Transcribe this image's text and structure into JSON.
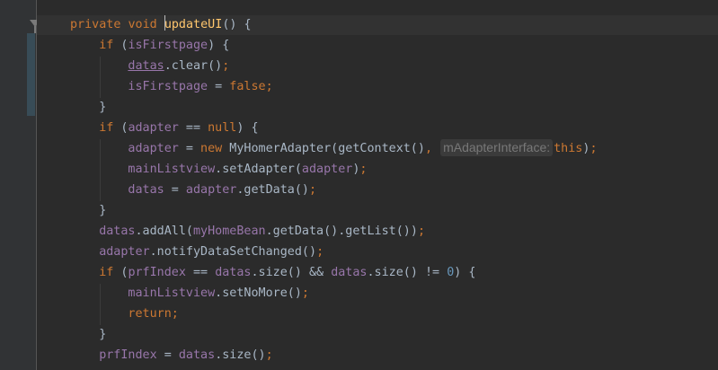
{
  "editor": {
    "lines": [
      {
        "indent": 0,
        "guides": [],
        "tokens": [
          {
            "t": "private void ",
            "c": "k"
          },
          {
            "t": "updateUI",
            "c": "m",
            "cursor_before": true
          },
          {
            "t": "() {",
            "c": "p"
          }
        ]
      },
      {
        "indent": 1,
        "guides": [],
        "tokens": [
          {
            "t": "if ",
            "c": "k"
          },
          {
            "t": "(",
            "c": "p"
          },
          {
            "t": "isFirstpage",
            "c": "f"
          },
          {
            "t": ") {",
            "c": "p"
          }
        ]
      },
      {
        "indent": 2,
        "guides": [
          1
        ],
        "tokens": [
          {
            "t": "datas",
            "c": "mu"
          },
          {
            "t": ".clear()",
            "c": "p"
          },
          {
            "t": ";",
            "c": "k"
          }
        ]
      },
      {
        "indent": 2,
        "guides": [
          1
        ],
        "tokens": [
          {
            "t": "isFirstpage",
            "c": "f"
          },
          {
            "t": " = ",
            "c": "p"
          },
          {
            "t": "false",
            "c": "k"
          },
          {
            "t": ";",
            "c": "k"
          }
        ]
      },
      {
        "indent": 1,
        "guides": [],
        "tokens": [
          {
            "t": "}",
            "c": "p"
          }
        ]
      },
      {
        "indent": 1,
        "guides": [],
        "tokens": [
          {
            "t": "if ",
            "c": "k"
          },
          {
            "t": "(",
            "c": "p"
          },
          {
            "t": "adapter",
            "c": "f"
          },
          {
            "t": " == ",
            "c": "p"
          },
          {
            "t": "null",
            "c": "k"
          },
          {
            "t": ") {",
            "c": "p"
          }
        ]
      },
      {
        "indent": 2,
        "guides": [
          1
        ],
        "tokens": [
          {
            "t": "adapter",
            "c": "f"
          },
          {
            "t": " = ",
            "c": "p"
          },
          {
            "t": "new ",
            "c": "k"
          },
          {
            "t": "MyHomerAdapter(getContext()",
            "c": "p"
          },
          {
            "t": ", ",
            "c": "k"
          },
          {
            "t": "mAdapterInterface:",
            "c": "hint"
          },
          {
            "t": "this",
            "c": "k"
          },
          {
            "t": ")",
            "c": "p"
          },
          {
            "t": ";",
            "c": "k"
          }
        ]
      },
      {
        "indent": 2,
        "guides": [
          1
        ],
        "tokens": [
          {
            "t": "mainListview",
            "c": "f"
          },
          {
            "t": ".setAdapter(",
            "c": "p"
          },
          {
            "t": "adapter",
            "c": "f"
          },
          {
            "t": ")",
            "c": "p"
          },
          {
            "t": ";",
            "c": "k"
          }
        ]
      },
      {
        "indent": 2,
        "guides": [
          1
        ],
        "tokens": [
          {
            "t": "datas",
            "c": "f"
          },
          {
            "t": " = ",
            "c": "p"
          },
          {
            "t": "adapter",
            "c": "f"
          },
          {
            "t": ".getData()",
            "c": "p"
          },
          {
            "t": ";",
            "c": "k"
          }
        ]
      },
      {
        "indent": 1,
        "guides": [],
        "tokens": [
          {
            "t": "}",
            "c": "p"
          }
        ]
      },
      {
        "indent": 1,
        "guides": [],
        "tokens": [
          {
            "t": "datas",
            "c": "f"
          },
          {
            "t": ".addAll(",
            "c": "p"
          },
          {
            "t": "myHomeBean",
            "c": "f"
          },
          {
            "t": ".getData().getList())",
            "c": "p"
          },
          {
            "t": ";",
            "c": "k"
          }
        ]
      },
      {
        "indent": 1,
        "guides": [],
        "tokens": [
          {
            "t": "adapter",
            "c": "f"
          },
          {
            "t": ".notifyDataSetChanged()",
            "c": "p"
          },
          {
            "t": ";",
            "c": "k"
          }
        ]
      },
      {
        "indent": 1,
        "guides": [],
        "tokens": [
          {
            "t": "if ",
            "c": "k"
          },
          {
            "t": "(",
            "c": "p"
          },
          {
            "t": "prfIndex",
            "c": "f"
          },
          {
            "t": " == ",
            "c": "p"
          },
          {
            "t": "datas",
            "c": "f"
          },
          {
            "t": ".size() && ",
            "c": "p"
          },
          {
            "t": "datas",
            "c": "f"
          },
          {
            "t": ".size() != ",
            "c": "p"
          },
          {
            "t": "0",
            "c": "n"
          },
          {
            "t": ") {",
            "c": "p"
          }
        ]
      },
      {
        "indent": 2,
        "guides": [
          1
        ],
        "tokens": [
          {
            "t": "mainListview",
            "c": "f"
          },
          {
            "t": ".setNoMore()",
            "c": "p"
          },
          {
            "t": ";",
            "c": "k"
          }
        ]
      },
      {
        "indent": 2,
        "guides": [
          1
        ],
        "tokens": [
          {
            "t": "return",
            "c": "k"
          },
          {
            "t": ";",
            "c": "k"
          }
        ]
      },
      {
        "indent": 1,
        "guides": [],
        "tokens": [
          {
            "t": "}",
            "c": "p"
          }
        ]
      },
      {
        "indent": 1,
        "guides": [],
        "tokens": [
          {
            "t": "prfIndex",
            "c": "f"
          },
          {
            "t": " = ",
            "c": "p"
          },
          {
            "t": "datas",
            "c": "f"
          },
          {
            "t": ".size()",
            "c": "p"
          },
          {
            "t": ";",
            "c": "k"
          }
        ]
      }
    ]
  },
  "colors": {
    "background": "#2b2b2b",
    "gutter": "#313335",
    "keyword": "#cc7832",
    "field": "#9876aa",
    "method": "#ffc66d",
    "number": "#6897bb",
    "plain": "#a9b7c6",
    "hint_text": "#787878",
    "hint_background": "#3b3b3b"
  },
  "icons": {
    "fold": "fold-collapse-icon"
  }
}
